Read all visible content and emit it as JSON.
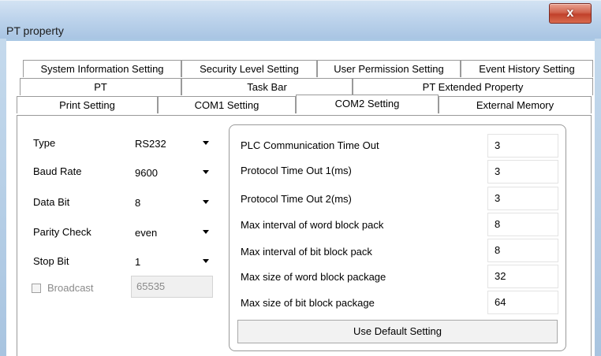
{
  "window": {
    "title": "PT property",
    "close_symbol": "x"
  },
  "tabs": {
    "row1": [
      "System Information Setting",
      "Security Level Setting",
      "User Permission Setting",
      "Event History Setting"
    ],
    "row2": [
      "PT",
      "Task Bar",
      "PT Extended Property"
    ],
    "row3": [
      "Print Setting",
      "COM1 Setting",
      "COM2 Setting",
      "External Memory"
    ],
    "active": "COM2 Setting"
  },
  "left_form": {
    "type": {
      "label": "Type",
      "value": "RS232"
    },
    "baud_rate": {
      "label": "Baud Rate",
      "value": "9600"
    },
    "data_bit": {
      "label": "Data Bit",
      "value": "8"
    },
    "parity_check": {
      "label": "Parity Check",
      "value": "even"
    },
    "stop_bit": {
      "label": "Stop Bit",
      "value": "1"
    },
    "broadcast": {
      "label": "Broadcast",
      "checked": false,
      "value": "65535"
    }
  },
  "right_form": {
    "rows": [
      {
        "label": "PLC Communication Time Out",
        "value": "3"
      },
      {
        "label": "Protocol Time Out 1(ms)",
        "value": "3"
      },
      {
        "label": "Protocol Time Out 2(ms)",
        "value": "3"
      },
      {
        "label": "Max interval of word block pack",
        "value": "8"
      },
      {
        "label": "Max interval of bit block pack",
        "value": "8"
      },
      {
        "label": "Max size of word block package",
        "value": "32"
      },
      {
        "label": "Max size of bit block package",
        "value": "64"
      }
    ],
    "default_button": "Use Default Setting"
  }
}
